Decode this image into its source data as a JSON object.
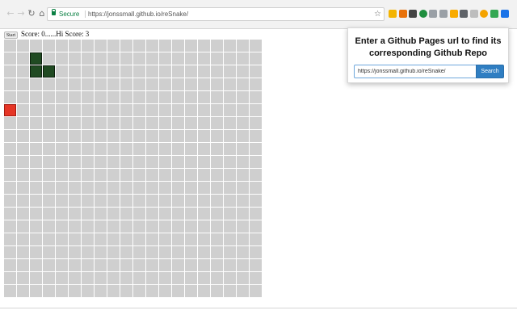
{
  "browser": {
    "url_secure_label": "Secure",
    "url": "https://jonssmall.github.io/reSnake/",
    "nav": {
      "back_icon": "back-arrow-icon",
      "forward_icon": "forward-arrow-icon",
      "reload_icon": "reload-icon",
      "home_icon": "home-icon"
    },
    "extension_icons": [
      {
        "name": "google-drive-extension-icon",
        "color": "#f4b400"
      },
      {
        "name": "bookmark-extension-icon",
        "color": "#e8710a"
      },
      {
        "name": "crop-extension-icon",
        "color": "#444444"
      },
      {
        "name": "green-circle-extension-icon",
        "color": "#1e8e3e"
      },
      {
        "name": "shield-extension-icon",
        "color": "#9aa0a6"
      },
      {
        "name": "grid-extension-icon",
        "color": "#9aa0a6"
      },
      {
        "name": "rss-extension-icon",
        "color": "#f9ab00"
      },
      {
        "name": "puzzle-extension-icon",
        "color": "#5f6368"
      },
      {
        "name": "dot-extension-icon",
        "color": "#bdbdbd"
      },
      {
        "name": "orange-extension-icon",
        "color": "#f4a300"
      },
      {
        "name": "green-square-extension-icon",
        "color": "#34a853"
      },
      {
        "name": "github-repo-finder-extension-icon",
        "color": "#1a73e8"
      }
    ]
  },
  "game": {
    "start_label": "Start",
    "score_text": "Score: 0......Hi Score: 3",
    "grid": {
      "cols": 20,
      "rows": 20
    },
    "snake_cells": [
      [
        2,
        1
      ],
      [
        2,
        2
      ],
      [
        3,
        2
      ]
    ],
    "food_cell": [
      0,
      5
    ],
    "colors": {
      "empty": "#cfcfcf",
      "snake": "#204a22",
      "food": "#e53525"
    }
  },
  "popup": {
    "title": "Enter a Github Pages url to find its corresponding Github Repo",
    "input_value": "https://jonssmall.github.io/reSnake/",
    "search_label": "Search"
  }
}
